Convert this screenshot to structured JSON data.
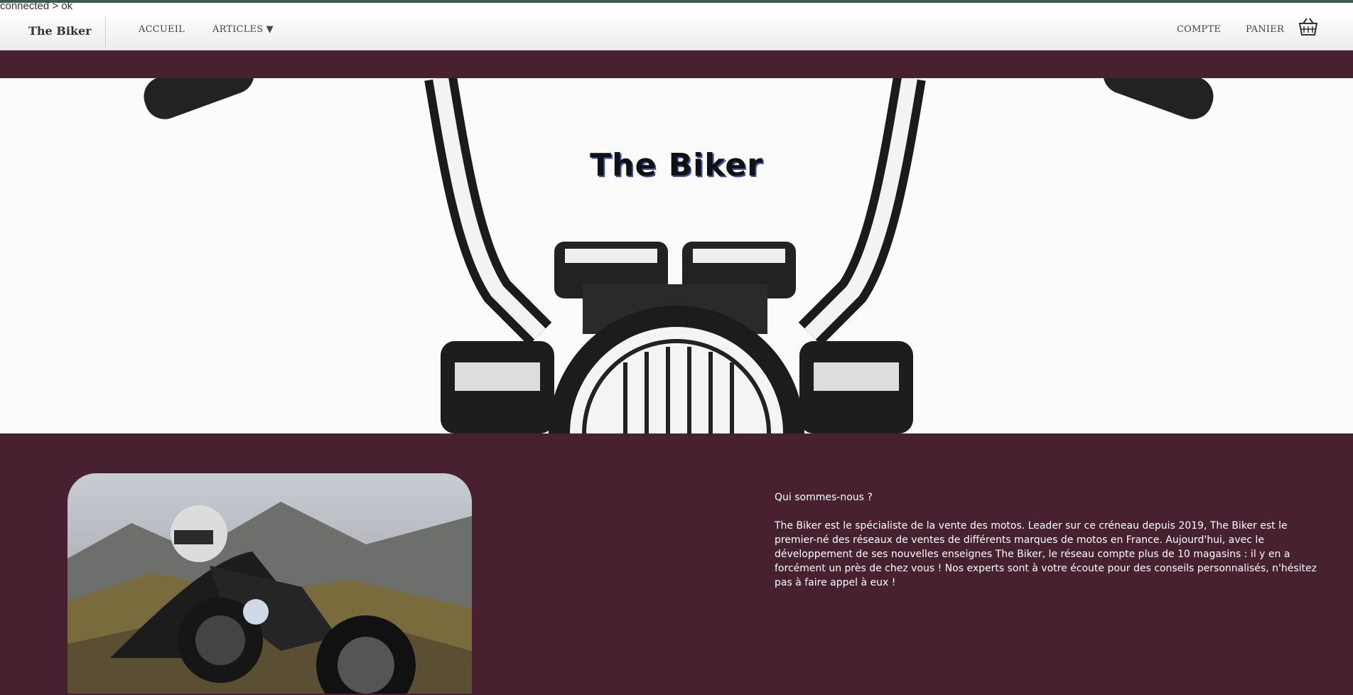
{
  "debug_status": "connected > ok",
  "nav": {
    "brand": "The Biker",
    "accueil": "ACCUEIL",
    "articles": "ARTICLES ▼",
    "compte": "COMPTE",
    "panier": "PANIER",
    "cart_icon": "basket-icon"
  },
  "hero": {
    "title": "The Biker",
    "illustration": "motorcycle-handlebars-illustration"
  },
  "about": {
    "heading": "Qui sommes-nous ?",
    "body": "The Biker est le spécialiste de la vente des motos. Leader sur ce créneau depuis 2019, The Biker est le premier-né des réseaux de ventes de différents marques de motos en France. Aujourd'hui, avec le développement de ses nouvelles enseignes The Biker, le réseau compte plus de 10 magasins : il y en a forcément un près de chez vous ! Nos experts sont à votre écoute pour des conseils personnalisés, n'hésitez pas à faire appel à eux !"
  },
  "photo": {
    "subject": "motorcycle-rider-photo"
  },
  "colors": {
    "accent": "#47212f",
    "navbar_bg": "#f5f5f5",
    "hero_bg": "#fbfbfb",
    "title_shadow": "#3a4fb0"
  }
}
